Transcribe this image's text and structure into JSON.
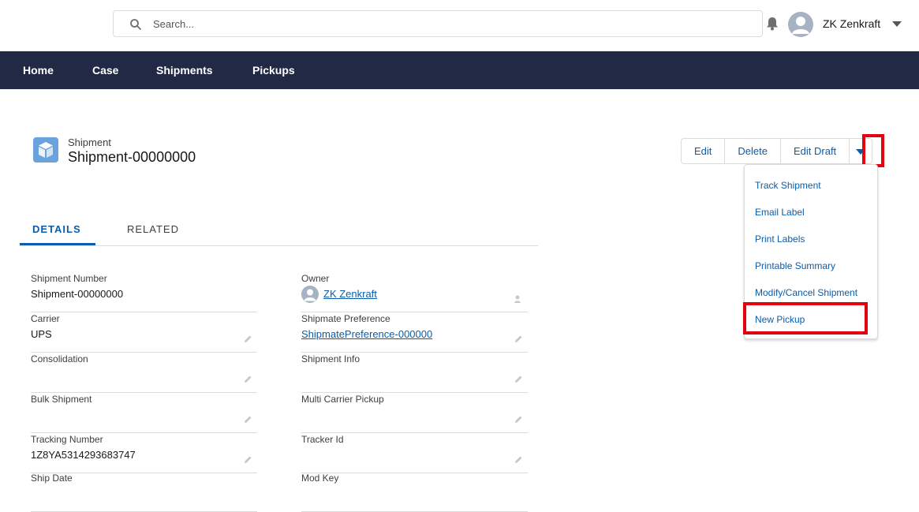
{
  "header": {
    "search_placeholder": "Search...",
    "user_name": "ZK Zenkraft"
  },
  "nav": {
    "items": [
      {
        "label": "Home"
      },
      {
        "label": "Case"
      },
      {
        "label": "Shipments"
      },
      {
        "label": "Pickups"
      }
    ]
  },
  "record": {
    "type": "Shipment",
    "name": "Shipment-00000000"
  },
  "actions": {
    "edit": "Edit",
    "delete": "Delete",
    "edit_draft": "Edit Draft"
  },
  "menu": {
    "items": [
      {
        "label": "Track Shipment"
      },
      {
        "label": "Email Label"
      },
      {
        "label": "Print Labels"
      },
      {
        "label": "Printable Summary"
      },
      {
        "label": "Modify/Cancel Shipment"
      },
      {
        "label": "New Pickup"
      }
    ]
  },
  "tabs": {
    "details": "DETAILS",
    "related": "RELATED"
  },
  "fields": {
    "left": [
      {
        "label": "Shipment Number",
        "value": "Shipment-00000000"
      },
      {
        "label": "Carrier",
        "value": "UPS"
      },
      {
        "label": "Consolidation",
        "value": ""
      },
      {
        "label": "Bulk Shipment",
        "value": ""
      },
      {
        "label": "Tracking Number",
        "value": "1Z8YA5314293683747"
      },
      {
        "label": "Ship Date",
        "value": ""
      }
    ],
    "right": [
      {
        "label": "Owner",
        "value": "ZK Zenkraft"
      },
      {
        "label": "Shipmate Preference",
        "value": "ShipmatePreference-000000"
      },
      {
        "label": "Shipment Info",
        "value": ""
      },
      {
        "label": "Multi Carrier Pickup",
        "value": ""
      },
      {
        "label": "Tracker Id",
        "value": ""
      },
      {
        "label": "Mod Key",
        "value": ""
      }
    ]
  },
  "colors": {
    "nav_bg": "#212945",
    "link": "#0b5cab",
    "highlight": "#e3000f",
    "record_icon": "#6aa2de"
  }
}
